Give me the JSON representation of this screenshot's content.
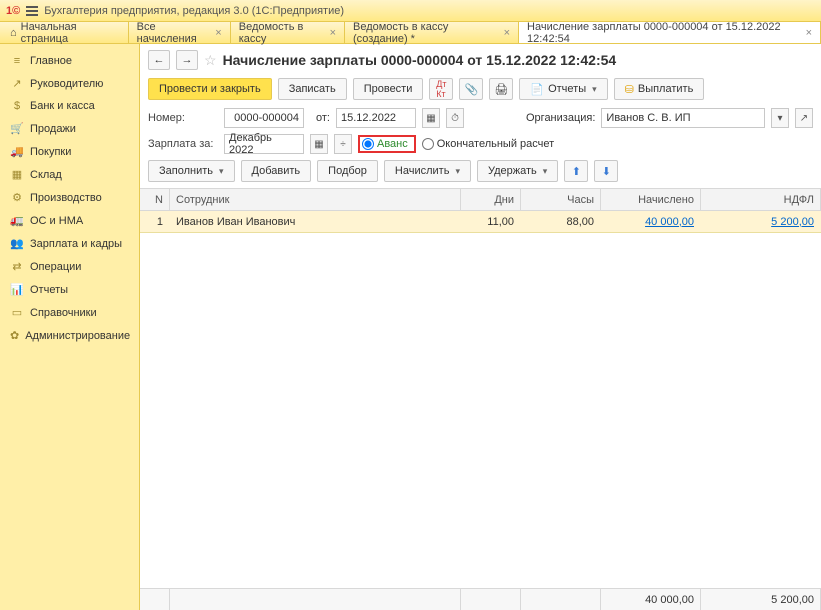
{
  "app_title": "Бухгалтерия предприятия, редакция 3.0  (1С:Предприятие)",
  "tabs": {
    "home": "Начальная страница",
    "t1": "Все начисления",
    "t2": "Ведомость в кассу",
    "t3": "Ведомость в кассу (создание) *",
    "t4": "Начисление зарплаты 0000-000004 от 15.12.2022 12:42:54"
  },
  "sidebar": [
    "Главное",
    "Руководителю",
    "Банк и касса",
    "Продажи",
    "Покупки",
    "Склад",
    "Производство",
    "ОС и НМА",
    "Зарплата и кадры",
    "Операции",
    "Отчеты",
    "Справочники",
    "Администрирование"
  ],
  "sidebar_icons": [
    "≡",
    "✎",
    "⛁",
    "✓",
    "⛟",
    "⛟",
    "⛃",
    "⚙",
    "⛟",
    "⚖",
    "✎",
    "↯",
    "☷",
    "⚙"
  ],
  "page_title": "Начисление зарплаты 0000-000004 от 15.12.2022 12:42:54",
  "tb": {
    "provesti": "Провести и закрыть",
    "zapisat": "Записать",
    "provesti2": "Провести",
    "otchety": "Отчеты",
    "vyplatit": "Выплатить"
  },
  "form": {
    "nomer_lbl": "Номер:",
    "nomer": "0000-000004",
    "ot_lbl": "от:",
    "date": "15.12.2022",
    "org_lbl": "Организация:",
    "org": "Иванов С. В. ИП",
    "zarp_lbl": "Зарплата за:",
    "period": "Декабрь 2022",
    "avans": "Аванс",
    "okonch": "Окончательный расчет"
  },
  "tb2": {
    "zapolnit": "Заполнить",
    "dobavit": "Добавить",
    "podbor": "Подбор",
    "nachislit": "Начислить",
    "uderzhat": "Удержать"
  },
  "grid": {
    "h": {
      "n": "N",
      "emp": "Сотрудник",
      "dni": "Дни",
      "chasy": "Часы",
      "nach": "Начислено",
      "ndfl": "НДФЛ"
    },
    "rows": [
      {
        "n": "1",
        "emp": "Иванов Иван Иванович",
        "dni": "11,00",
        "chasy": "88,00",
        "nach": "40 000,00",
        "ndfl": "5 200,00"
      }
    ]
  },
  "footer": {
    "nach": "40 000,00",
    "ndfl": "5 200,00"
  }
}
